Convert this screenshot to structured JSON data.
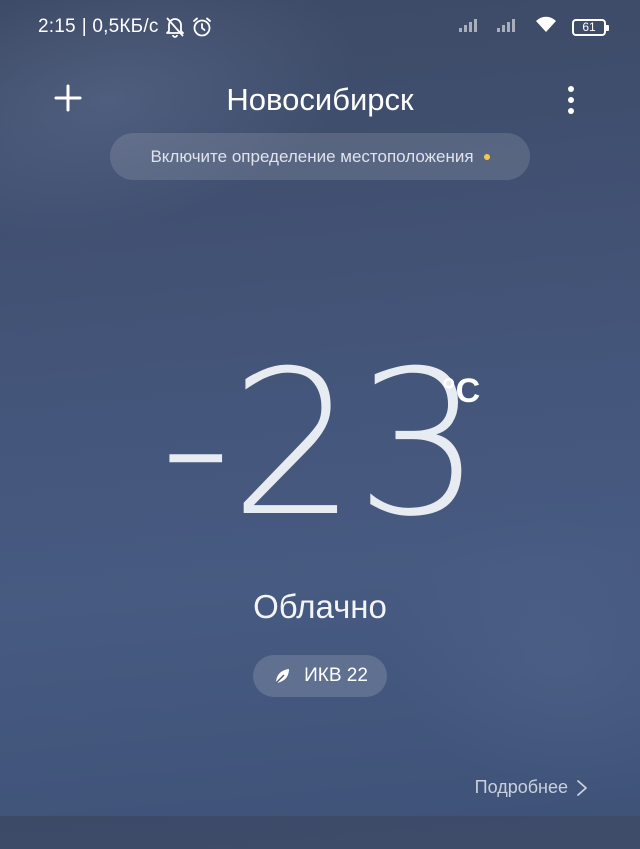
{
  "status_bar": {
    "time": "2:15",
    "network_speed": "| 0,5КБ/с",
    "battery_level": "61",
    "icons": [
      "muted-bell-icon",
      "alarm-icon",
      "signal-icon",
      "signal-icon",
      "wifi-icon",
      "battery-icon"
    ]
  },
  "header": {
    "city": "Новосибирск",
    "add_icon": "plus-icon",
    "menu_icon": "more-vert-icon"
  },
  "location_prompt": {
    "text": "Включите определение местоположения",
    "dot_color": "#f2c94c"
  },
  "weather": {
    "temperature": "-23",
    "unit": "°C",
    "condition": "Облачно"
  },
  "aqi": {
    "label": "ИКВ 22",
    "icon": "leaf-icon"
  },
  "details": {
    "label": "Подробнее",
    "icon": "chevron-right-icon"
  },
  "colors": {
    "background_top": "#3d4a66",
    "background_bottom": "#475a81",
    "accent_dot": "#f2c94c"
  }
}
